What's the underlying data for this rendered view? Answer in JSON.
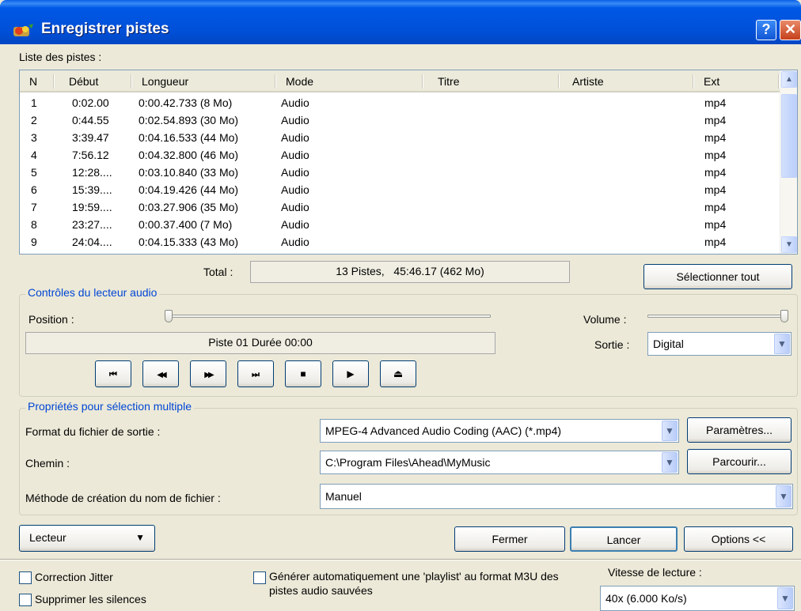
{
  "window": {
    "title": "Enregistrer pistes"
  },
  "tracklist": {
    "label": "Liste des pistes :",
    "columns": [
      "N",
      "Début",
      "Longueur",
      "Mode",
      "Titre",
      "Artiste",
      "Ext"
    ],
    "rows": [
      {
        "n": "1",
        "debut": "0:02.00",
        "longueur": "0:00.42.733 (8 Mo)",
        "mode": "Audio",
        "titre": "",
        "artiste": "",
        "ext": "mp4"
      },
      {
        "n": "2",
        "debut": "0:44.55",
        "longueur": "0:02.54.893 (30 Mo)",
        "mode": "Audio",
        "titre": "",
        "artiste": "",
        "ext": "mp4"
      },
      {
        "n": "3",
        "debut": "3:39.47",
        "longueur": "0:04.16.533 (44 Mo)",
        "mode": "Audio",
        "titre": "",
        "artiste": "",
        "ext": "mp4"
      },
      {
        "n": "4",
        "debut": "7:56.12",
        "longueur": "0:04.32.800 (46 Mo)",
        "mode": "Audio",
        "titre": "",
        "artiste": "",
        "ext": "mp4"
      },
      {
        "n": "5",
        "debut": "12:28....",
        "longueur": "0:03.10.840 (33 Mo)",
        "mode": "Audio",
        "titre": "",
        "artiste": "",
        "ext": "mp4"
      },
      {
        "n": "6",
        "debut": "15:39....",
        "longueur": "0:04.19.426 (44 Mo)",
        "mode": "Audio",
        "titre": "",
        "artiste": "",
        "ext": "mp4"
      },
      {
        "n": "7",
        "debut": "19:59....",
        "longueur": "0:03.27.906 (35 Mo)",
        "mode": "Audio",
        "titre": "",
        "artiste": "",
        "ext": "mp4"
      },
      {
        "n": "8",
        "debut": "23:27....",
        "longueur": "0:00.37.400 (7 Mo)",
        "mode": "Audio",
        "titre": "",
        "artiste": "",
        "ext": "mp4"
      },
      {
        "n": "9",
        "debut": "24:04....",
        "longueur": "0:04.15.333 (43 Mo)",
        "mode": "Audio",
        "titre": "",
        "artiste": "",
        "ext": "mp4"
      }
    ]
  },
  "total": {
    "label": "Total :",
    "value": "13 Pistes,   45:46.17 (462 Mo)"
  },
  "select_all_label": "Sélectionner tout",
  "player": {
    "group_title": "Contrôles du lecteur audio",
    "position_label": "Position :",
    "volume_label": "Volume :",
    "status": "Piste 01 Durée 00:00",
    "output_label": "Sortie :",
    "output_value": "Digital",
    "buttons": [
      {
        "name": "first-track",
        "glyph": "⏮"
      },
      {
        "name": "rewind",
        "glyph": "◀◀"
      },
      {
        "name": "fast-forward",
        "glyph": "▶▶"
      },
      {
        "name": "last-track",
        "glyph": "⏭"
      },
      {
        "name": "stop",
        "glyph": "■"
      },
      {
        "name": "play",
        "glyph": "▶"
      },
      {
        "name": "eject",
        "glyph": "⏏"
      }
    ]
  },
  "properties": {
    "group_title": "Propriétés pour sélection multiple",
    "format_label": "Format du fichier de sortie :",
    "format_value": "MPEG-4 Advanced Audio Coding (AAC) (*.mp4)",
    "settings_button": "Paramètres...",
    "path_label": "Chemin :",
    "path_value": "C:\\Program Files\\Ahead\\MyMusic",
    "browse_button": "Parcourir...",
    "naming_label": "Méthode de création du nom de fichier :",
    "naming_value": "Manuel"
  },
  "actions": {
    "player_menu": "Lecteur",
    "close": "Fermer",
    "start": "Lancer",
    "options": "Options <<"
  },
  "options": {
    "jitter": "Correction Jitter",
    "silence": "Supprimer les silences",
    "playlist": "Générer automatiquement une 'playlist' au format M3U des pistes audio sauvées",
    "speed_label": "Vitesse de lecture :",
    "speed_value": "40x (6.000 Ko/s)"
  },
  "colors": {
    "titlebar": "#0054E3",
    "group_title": "#0046D5",
    "background": "#ECE9D8"
  }
}
